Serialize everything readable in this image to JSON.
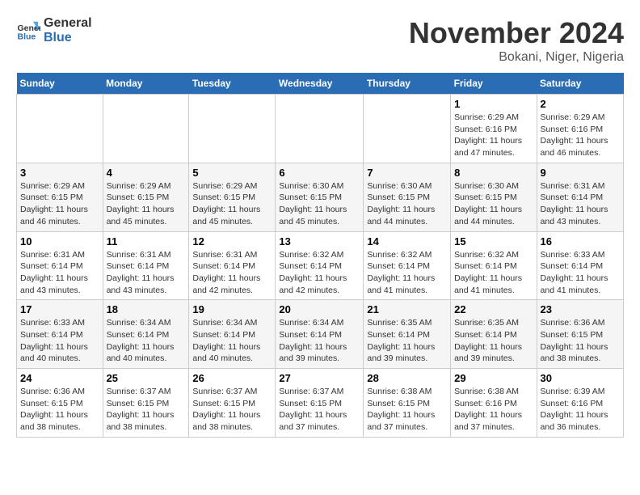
{
  "header": {
    "logo_general": "General",
    "logo_blue": "Blue",
    "month_title": "November 2024",
    "location": "Bokani, Niger, Nigeria"
  },
  "weekdays": [
    "Sunday",
    "Monday",
    "Tuesday",
    "Wednesday",
    "Thursday",
    "Friday",
    "Saturday"
  ],
  "weeks": [
    [
      {
        "day": "",
        "info": ""
      },
      {
        "day": "",
        "info": ""
      },
      {
        "day": "",
        "info": ""
      },
      {
        "day": "",
        "info": ""
      },
      {
        "day": "",
        "info": ""
      },
      {
        "day": "1",
        "info": "Sunrise: 6:29 AM\nSunset: 6:16 PM\nDaylight: 11 hours and 47 minutes."
      },
      {
        "day": "2",
        "info": "Sunrise: 6:29 AM\nSunset: 6:16 PM\nDaylight: 11 hours and 46 minutes."
      }
    ],
    [
      {
        "day": "3",
        "info": "Sunrise: 6:29 AM\nSunset: 6:15 PM\nDaylight: 11 hours and 46 minutes."
      },
      {
        "day": "4",
        "info": "Sunrise: 6:29 AM\nSunset: 6:15 PM\nDaylight: 11 hours and 45 minutes."
      },
      {
        "day": "5",
        "info": "Sunrise: 6:29 AM\nSunset: 6:15 PM\nDaylight: 11 hours and 45 minutes."
      },
      {
        "day": "6",
        "info": "Sunrise: 6:30 AM\nSunset: 6:15 PM\nDaylight: 11 hours and 45 minutes."
      },
      {
        "day": "7",
        "info": "Sunrise: 6:30 AM\nSunset: 6:15 PM\nDaylight: 11 hours and 44 minutes."
      },
      {
        "day": "8",
        "info": "Sunrise: 6:30 AM\nSunset: 6:15 PM\nDaylight: 11 hours and 44 minutes."
      },
      {
        "day": "9",
        "info": "Sunrise: 6:31 AM\nSunset: 6:14 PM\nDaylight: 11 hours and 43 minutes."
      }
    ],
    [
      {
        "day": "10",
        "info": "Sunrise: 6:31 AM\nSunset: 6:14 PM\nDaylight: 11 hours and 43 minutes."
      },
      {
        "day": "11",
        "info": "Sunrise: 6:31 AM\nSunset: 6:14 PM\nDaylight: 11 hours and 43 minutes."
      },
      {
        "day": "12",
        "info": "Sunrise: 6:31 AM\nSunset: 6:14 PM\nDaylight: 11 hours and 42 minutes."
      },
      {
        "day": "13",
        "info": "Sunrise: 6:32 AM\nSunset: 6:14 PM\nDaylight: 11 hours and 42 minutes."
      },
      {
        "day": "14",
        "info": "Sunrise: 6:32 AM\nSunset: 6:14 PM\nDaylight: 11 hours and 41 minutes."
      },
      {
        "day": "15",
        "info": "Sunrise: 6:32 AM\nSunset: 6:14 PM\nDaylight: 11 hours and 41 minutes."
      },
      {
        "day": "16",
        "info": "Sunrise: 6:33 AM\nSunset: 6:14 PM\nDaylight: 11 hours and 41 minutes."
      }
    ],
    [
      {
        "day": "17",
        "info": "Sunrise: 6:33 AM\nSunset: 6:14 PM\nDaylight: 11 hours and 40 minutes."
      },
      {
        "day": "18",
        "info": "Sunrise: 6:34 AM\nSunset: 6:14 PM\nDaylight: 11 hours and 40 minutes."
      },
      {
        "day": "19",
        "info": "Sunrise: 6:34 AM\nSunset: 6:14 PM\nDaylight: 11 hours and 40 minutes."
      },
      {
        "day": "20",
        "info": "Sunrise: 6:34 AM\nSunset: 6:14 PM\nDaylight: 11 hours and 39 minutes."
      },
      {
        "day": "21",
        "info": "Sunrise: 6:35 AM\nSunset: 6:14 PM\nDaylight: 11 hours and 39 minutes."
      },
      {
        "day": "22",
        "info": "Sunrise: 6:35 AM\nSunset: 6:14 PM\nDaylight: 11 hours and 39 minutes."
      },
      {
        "day": "23",
        "info": "Sunrise: 6:36 AM\nSunset: 6:15 PM\nDaylight: 11 hours and 38 minutes."
      }
    ],
    [
      {
        "day": "24",
        "info": "Sunrise: 6:36 AM\nSunset: 6:15 PM\nDaylight: 11 hours and 38 minutes."
      },
      {
        "day": "25",
        "info": "Sunrise: 6:37 AM\nSunset: 6:15 PM\nDaylight: 11 hours and 38 minutes."
      },
      {
        "day": "26",
        "info": "Sunrise: 6:37 AM\nSunset: 6:15 PM\nDaylight: 11 hours and 38 minutes."
      },
      {
        "day": "27",
        "info": "Sunrise: 6:37 AM\nSunset: 6:15 PM\nDaylight: 11 hours and 37 minutes."
      },
      {
        "day": "28",
        "info": "Sunrise: 6:38 AM\nSunset: 6:15 PM\nDaylight: 11 hours and 37 minutes."
      },
      {
        "day": "29",
        "info": "Sunrise: 6:38 AM\nSunset: 6:16 PM\nDaylight: 11 hours and 37 minutes."
      },
      {
        "day": "30",
        "info": "Sunrise: 6:39 AM\nSunset: 6:16 PM\nDaylight: 11 hours and 36 minutes."
      }
    ]
  ]
}
